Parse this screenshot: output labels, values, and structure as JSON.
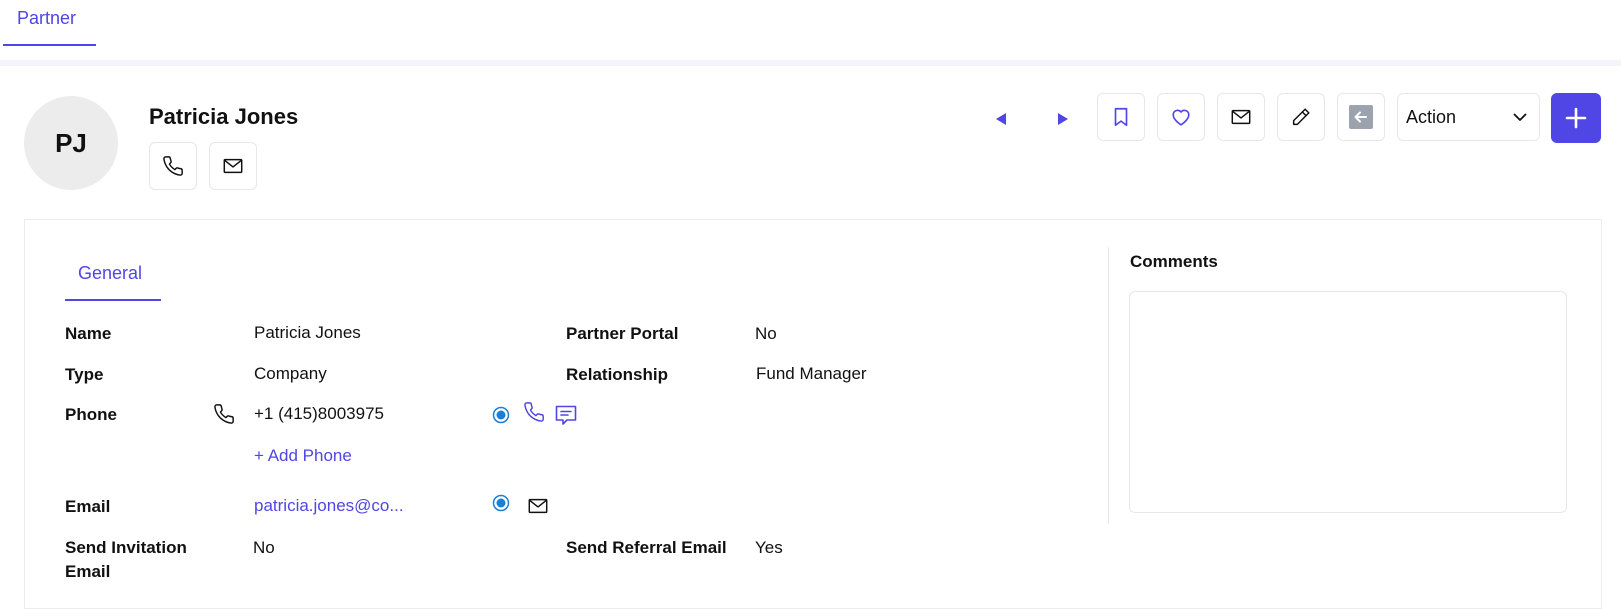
{
  "top_tab": {
    "label": "Partner"
  },
  "header": {
    "avatar_initials": "PJ",
    "name": "Patricia Jones",
    "action_select": {
      "selected": "Action"
    }
  },
  "icons": {
    "prev": "triangle-left-icon",
    "next": "triangle-right-icon",
    "bookmark": "bookmark-icon",
    "favorite": "heart-icon",
    "email": "envelope-icon",
    "edit": "pencil-icon",
    "back": "arrow-left-icon",
    "add": "plus-icon",
    "phone": "phone-icon",
    "sms": "chat-icon",
    "radio": "radio-selected-icon"
  },
  "colors": {
    "accent": "#4f46e5",
    "radio": "#1d7fd1"
  },
  "section_tab": {
    "label": "General"
  },
  "fields": {
    "name": {
      "label": "Name",
      "value": "Patricia Jones"
    },
    "type": {
      "label": "Type",
      "value": "Company"
    },
    "phone": {
      "label": "Phone",
      "value": "+1 (415)8003975",
      "add_label": "+ Add Phone"
    },
    "email": {
      "label": "Email",
      "value": "patricia.jones@co..."
    },
    "send_invitation": {
      "label_line1": "Send Invitation",
      "label_line2": "Email",
      "value": "No"
    },
    "partner_portal": {
      "label": "Partner Portal",
      "value": "No"
    },
    "relationship": {
      "label": "Relationship",
      "value": "Fund Manager"
    },
    "send_referral": {
      "label": "Send Referral Email",
      "value": "Yes"
    }
  },
  "comments": {
    "label": "Comments",
    "value": ""
  }
}
